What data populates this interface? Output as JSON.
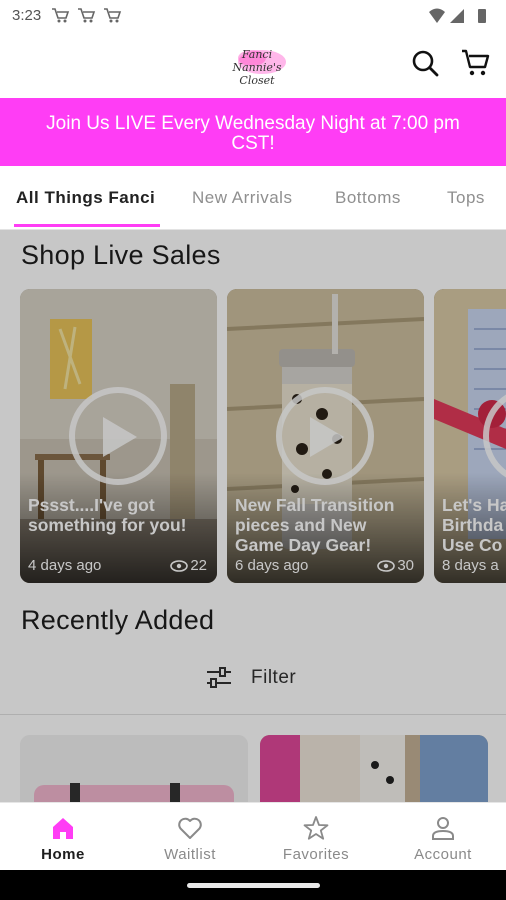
{
  "status_bar": {
    "time": "3:23",
    "left_icons": [
      "cart-notification-icon",
      "cart-notification-icon",
      "cart-notification-icon"
    ],
    "right_icons": [
      "wifi-icon",
      "signal-icon",
      "battery-icon"
    ]
  },
  "header": {
    "logo_text": "Fanci Nannie's Closet",
    "actions": [
      "search-icon",
      "cart-icon"
    ]
  },
  "banner": {
    "text": "Join Us LIVE Every Wednesday Night at 7:00 pm CST!",
    "color": "#ff3df5"
  },
  "tabs": [
    {
      "label": "All Things Fanci",
      "active": true
    },
    {
      "label": "New Arrivals",
      "active": false
    },
    {
      "label": "Bottoms",
      "active": false
    },
    {
      "label": "Tops",
      "active": false
    }
  ],
  "live_sales": {
    "title": "Shop Live Sales",
    "cards": [
      {
        "title_line1": "Pssst....I've got",
        "title_line2": "something for you!",
        "age": "4 days ago",
        "views": "22"
      },
      {
        "title_line1": "New Fall Transition",
        "title_line2": "pieces and New",
        "title_line3": "Game Day Gear!",
        "age": "6 days ago",
        "views": "30"
      },
      {
        "title_line1": "Let's Ha",
        "title_line2": "Birthda",
        "title_line3": "Use Co",
        "age": "8 days a"
      }
    ]
  },
  "recently_added": {
    "title": "Recently Added",
    "filter_label": "Filter"
  },
  "bottom_nav": [
    {
      "label": "Home",
      "icon": "home-icon",
      "active": true
    },
    {
      "label": "Waitlist",
      "icon": "heart-icon",
      "active": false
    },
    {
      "label": "Favorites",
      "icon": "star-icon",
      "active": false
    },
    {
      "label": "Account",
      "icon": "account-icon",
      "active": false
    }
  ],
  "colors": {
    "accent": "#ff3df5",
    "text": "#1e1e1e",
    "inactive": "#8a8a8a"
  }
}
